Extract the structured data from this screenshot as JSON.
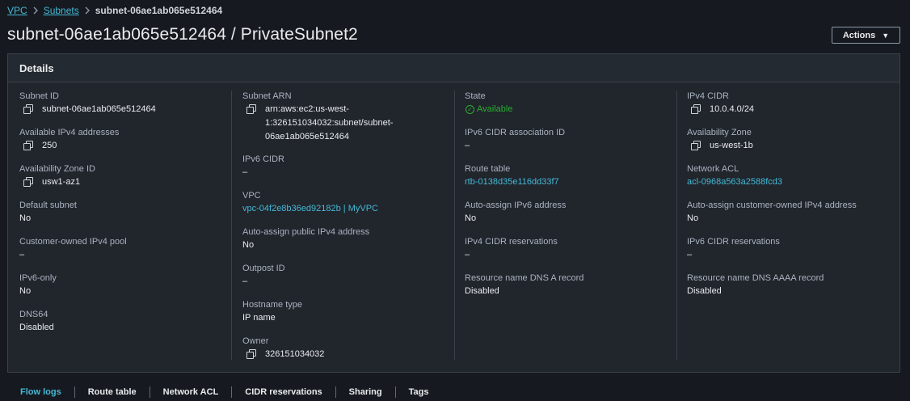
{
  "breadcrumb": {
    "items": [
      "VPC",
      "Subnets"
    ],
    "current": "subnet-06ae1ab065e512464"
  },
  "page_title": "subnet-06ae1ab065e512464 / PrivateSubnet2",
  "actions_label": "Actions",
  "details": {
    "header": "Details",
    "col1": [
      {
        "label": "Subnet ID",
        "value": "subnet-06ae1ab065e512464",
        "copy": true
      },
      {
        "label": "Available IPv4 addresses",
        "value": "250",
        "copy": true
      },
      {
        "label": "Availability Zone ID",
        "value": "usw1-az1",
        "copy": true
      },
      {
        "label": "Default subnet",
        "value": "No"
      },
      {
        "label": "Customer-owned IPv4 pool",
        "value": "–"
      },
      {
        "label": "IPv6-only",
        "value": "No"
      },
      {
        "label": "DNS64",
        "value": "Disabled"
      }
    ],
    "col2": [
      {
        "label": "Subnet ARN",
        "value": "arn:aws:ec2:us-west-\n1:326151034032:subnet/subnet-\n06ae1ab065e512464",
        "copy": true
      },
      {
        "label": "IPv6 CIDR",
        "value": "–"
      },
      {
        "label": "VPC",
        "value": "vpc-04f2e8b36ed92182b | MyVPC",
        "link": true
      },
      {
        "label": "Auto-assign public IPv4 address",
        "value": "No"
      },
      {
        "label": "Outpost ID",
        "value": "–"
      },
      {
        "label": "Hostname type",
        "value": "IP name"
      },
      {
        "label": "Owner",
        "value": "326151034032",
        "copy": true
      }
    ],
    "col3": [
      {
        "label": "State",
        "value": "Available",
        "status": true
      },
      {
        "label": "IPv6 CIDR association ID",
        "value": "–"
      },
      {
        "label": "Route table",
        "value": "rtb-0138d35e116dd33f7",
        "link": true
      },
      {
        "label": "Auto-assign IPv6 address",
        "value": "No"
      },
      {
        "label": "IPv4 CIDR reservations",
        "value": "–"
      },
      {
        "label": "Resource name DNS A record",
        "value": "Disabled"
      }
    ],
    "col4": [
      {
        "label": "IPv4 CIDR",
        "value": "10.0.4.0/24",
        "copy": true
      },
      {
        "label": "Availability Zone",
        "value": "us-west-1b",
        "copy": true
      },
      {
        "label": "Network ACL",
        "value": "acl-0968a563a2588fcd3",
        "link": true
      },
      {
        "label": "Auto-assign customer-owned IPv4 address",
        "value": "No"
      },
      {
        "label": "IPv6 CIDR reservations",
        "value": "–"
      },
      {
        "label": "Resource name DNS AAAA record",
        "value": "Disabled"
      }
    ]
  },
  "tabs": [
    "Flow logs",
    "Route table",
    "Network ACL",
    "CIDR reservations",
    "Sharing",
    "Tags"
  ],
  "colors": {
    "background": "#16191f",
    "panel": "#21252c",
    "link": "#44b9d6",
    "status_available": "#29ad32"
  },
  "icons": {
    "copy": "copy-icon",
    "status": "check-circle-icon",
    "breadcrumb_separator": "chevron-right-icon",
    "actions_caret": "caret-down-icon"
  }
}
